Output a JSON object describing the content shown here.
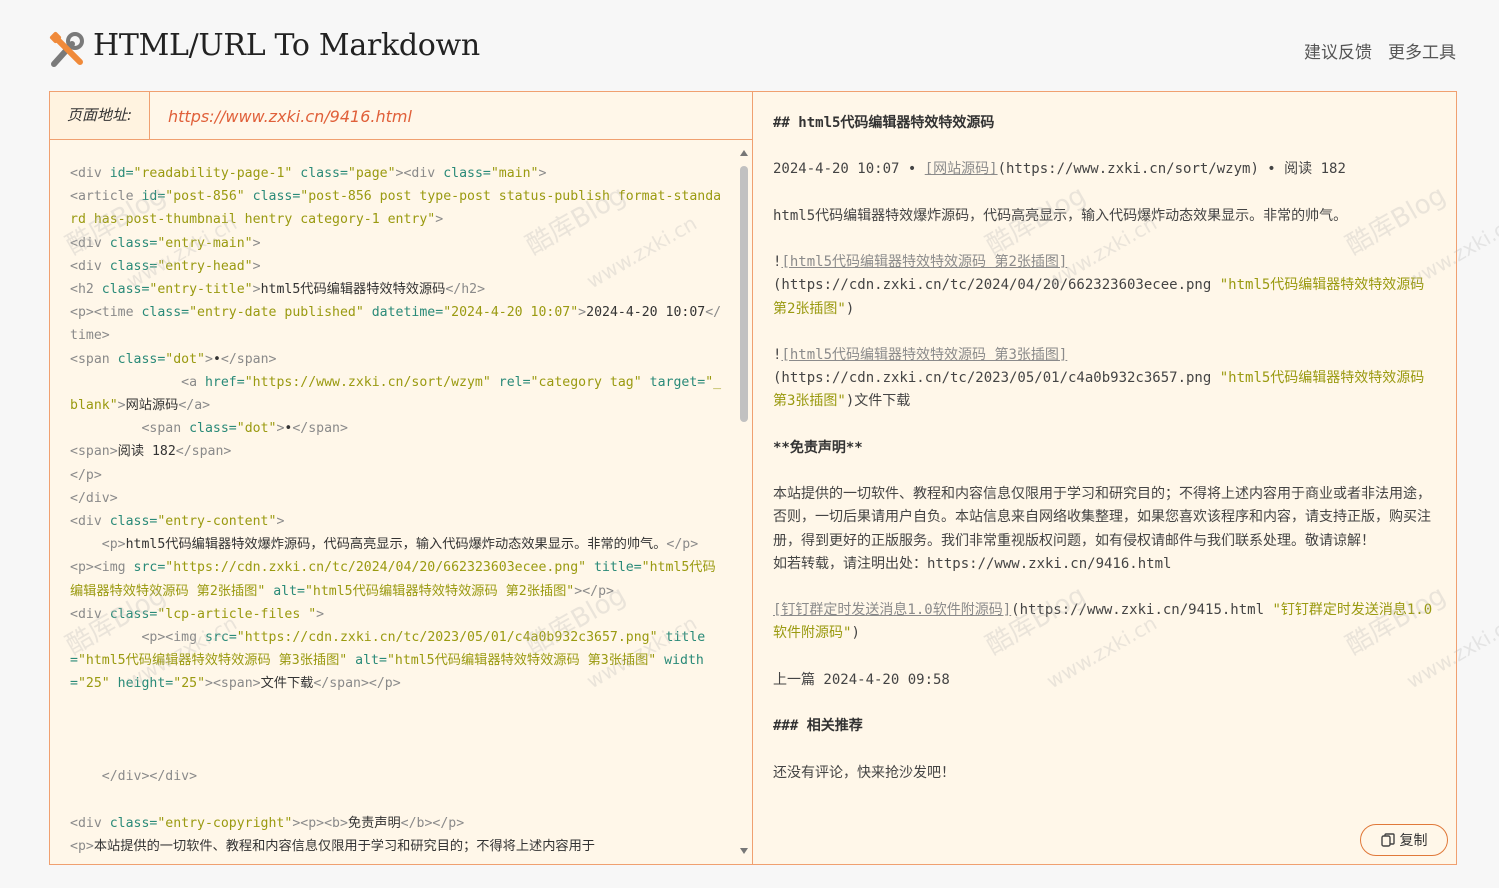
{
  "header": {
    "title": "HTML/URL To Markdown",
    "nav": [
      "建议反馈",
      "更多工具"
    ]
  },
  "url_bar": {
    "label": "页面地址:",
    "value": "https://www.zxki.cn/9416.html"
  },
  "code_lines": [
    [
      [
        "t",
        "<div "
      ],
      [
        "a",
        "id="
      ],
      [
        "v",
        "\"readability-page-1\""
      ],
      [
        "a",
        " class="
      ],
      [
        "v",
        "\"page\""
      ],
      [
        "t",
        "><div "
      ],
      [
        "a",
        "class="
      ],
      [
        "v",
        "\"main\""
      ],
      [
        "t",
        ">"
      ]
    ],
    [
      [
        "t",
        "<article "
      ],
      [
        "a",
        "id="
      ],
      [
        "v",
        "\"post-856\""
      ],
      [
        "a",
        " class="
      ],
      [
        "v",
        "\"post-856 post type-post status-publish format-standard has-post-thumbnail hentry category-1 entry\""
      ],
      [
        "t",
        ">"
      ]
    ],
    [
      [
        "t",
        "<div "
      ],
      [
        "a",
        "class="
      ],
      [
        "v",
        "\"entry-main\""
      ],
      [
        "t",
        ">"
      ]
    ],
    [
      [
        "t",
        "<div "
      ],
      [
        "a",
        "class="
      ],
      [
        "v",
        "\"entry-head\""
      ],
      [
        "t",
        ">"
      ]
    ],
    [
      [
        "t",
        "<h2 "
      ],
      [
        "a",
        "class="
      ],
      [
        "v",
        "\"entry-title\""
      ],
      [
        "t",
        ">"
      ],
      [
        "x",
        "html5代码编辑器特效特效源码"
      ],
      [
        "t",
        "</h2>"
      ]
    ],
    [
      [
        "t",
        "<p><time "
      ],
      [
        "a",
        "class="
      ],
      [
        "v",
        "\"entry-date published\""
      ],
      [
        "a",
        " datetime="
      ],
      [
        "v",
        "\"2024-4-20 10:07\""
      ],
      [
        "t",
        ">"
      ],
      [
        "x",
        "2024-4-20 10:07"
      ],
      [
        "t",
        "</time>"
      ]
    ],
    [
      [
        "t",
        "<span "
      ],
      [
        "a",
        "class="
      ],
      [
        "v",
        "\"dot\""
      ],
      [
        "t",
        ">"
      ],
      [
        "x",
        "•"
      ],
      [
        "t",
        "</span>"
      ]
    ],
    [
      [
        "x",
        "              "
      ],
      [
        "t",
        "<a "
      ],
      [
        "a",
        "href="
      ],
      [
        "v",
        "\"https://www.zxki.cn/sort/wzym\""
      ],
      [
        "a",
        " rel="
      ],
      [
        "v",
        "\"category tag\""
      ],
      [
        "a",
        " target="
      ],
      [
        "v",
        "\"_blank\""
      ],
      [
        "t",
        ">"
      ],
      [
        "x",
        "网站源码"
      ],
      [
        "t",
        "</a>"
      ]
    ],
    [
      [
        "x",
        "         "
      ],
      [
        "t",
        "<span "
      ],
      [
        "a",
        "class="
      ],
      [
        "v",
        "\"dot\""
      ],
      [
        "t",
        ">"
      ],
      [
        "x",
        "•"
      ],
      [
        "t",
        "</span>"
      ]
    ],
    [
      [
        "t",
        "<span>"
      ],
      [
        "x",
        "阅读 182"
      ],
      [
        "t",
        "</span>"
      ]
    ],
    [
      [
        "t",
        "</p>"
      ]
    ],
    [
      [
        "t",
        "</div>"
      ]
    ],
    [
      [
        "t",
        "<div "
      ],
      [
        "a",
        "class="
      ],
      [
        "v",
        "\"entry-content\""
      ],
      [
        "t",
        ">"
      ]
    ],
    [
      [
        "x",
        "    "
      ],
      [
        "t",
        "<p>"
      ],
      [
        "x",
        "html5代码编辑器特效爆炸源码，代码高亮显示，输入代码爆炸动态效果显示。非常的帅气。"
      ],
      [
        "t",
        "</p>"
      ]
    ],
    [
      [
        "t",
        "<p><img "
      ],
      [
        "a",
        "src="
      ],
      [
        "v",
        "\"https://cdn.zxki.cn/tc/2024/04/20/662323603ecee.png\""
      ],
      [
        "a",
        " title="
      ],
      [
        "v",
        "\"html5代码编辑器特效特效源码 第2张插图\""
      ],
      [
        "a",
        " alt="
      ],
      [
        "v",
        "\"html5代码编辑器特效特效源码 第2张插图\""
      ],
      [
        "t",
        "></p>"
      ]
    ],
    [
      [
        "t",
        "<div "
      ],
      [
        "a",
        "class="
      ],
      [
        "v",
        "\"lcp-article-files \""
      ],
      [
        "t",
        ">"
      ]
    ],
    [
      [
        "x",
        "         "
      ],
      [
        "t",
        "<p><img "
      ],
      [
        "a",
        "src="
      ],
      [
        "v",
        "\"https://cdn.zxki.cn/tc/2023/05/01/c4a0b932c3657.png\""
      ],
      [
        "a",
        " title="
      ],
      [
        "v",
        "\"html5代码编辑器特效特效源码 第3张插图\""
      ],
      [
        "a",
        " alt="
      ],
      [
        "v",
        "\"html5代码编辑器特效特效源码 第3张插图\""
      ],
      [
        "a",
        " width="
      ],
      [
        "v",
        "\"25\""
      ],
      [
        "a",
        " height="
      ],
      [
        "v",
        "\"25\""
      ],
      [
        "t",
        "><span>"
      ],
      [
        "x",
        "文件下载"
      ],
      [
        "t",
        "</span></p>"
      ]
    ],
    [
      [
        "x",
        ""
      ]
    ],
    [
      [
        "x",
        ""
      ]
    ],
    [
      [
        "x",
        ""
      ]
    ],
    [
      [
        "x",
        "    "
      ],
      [
        "t",
        "</div></div>"
      ]
    ],
    [
      [
        "x",
        ""
      ]
    ],
    [
      [
        "t",
        "<div "
      ],
      [
        "a",
        "class="
      ],
      [
        "v",
        "\"entry-copyright\""
      ],
      [
        "t",
        "><p><b>"
      ],
      [
        "x",
        "免责声明"
      ],
      [
        "t",
        "</b></p>"
      ]
    ],
    [
      [
        "t",
        "<p>"
      ],
      [
        "x",
        "本站提供的一切软件、教程和内容信息仅限用于学习和研究目的；不得将上述内容用于"
      ]
    ]
  ],
  "markdown": {
    "h2": "## html5代码编辑器特效特效源码",
    "meta_prefix": "2024-4-20 10:07 • ",
    "meta_link": "[网站源码]",
    "meta_suffix": "(https://www.zxki.cn/sort/wzym) • 阅读 182",
    "desc": "html5代码编辑器特效爆炸源码，代码高亮显示，输入代码爆炸动态效果显示。非常的帅气。",
    "img1_bang": "!",
    "img1_alt": "[html5代码编辑器特效特效源码 第2张插图]",
    "img1_url": "(https://cdn.zxki.cn/tc/2024/04/20/662323603ecee.png ",
    "img1_title": "\"html5代码编辑器特效特效源码 第2张插图\"",
    "img1_close": ")",
    "img2_bang": "!",
    "img2_alt": "[html5代码编辑器特效特效源码 第3张插图]",
    "img2_url": "(https://cdn.zxki.cn/tc/2023/05/01/c4a0b932c3657.png ",
    "img2_title": "\"html5代码编辑器特效特效源码 第3张插图\"",
    "img2_close": ")文件下载",
    "disclaimer_title": "**免责声明**",
    "disclaimer_body": "本站提供的一切软件、教程和内容信息仅限用于学习和研究目的；不得将上述内容用于商业或者非法用途，否则，一切后果请用户自负。本站信息来自网络收集整理，如果您喜欢该程序和内容，请支持正版，购买注册，得到更好的正版服务。我们非常重视版权问题，如有侵权请邮件与我们联系处理。敬请谅解！",
    "repost": "如若转载，请注明出处：https://www.zxki.cn/9416.html",
    "related_link": "[钉钉群定时发送消息1.0软件附源码]",
    "related_url": "(https://www.zxki.cn/9415.html ",
    "related_title": "\"钉钉群定时发送消息1.0软件附源码\"",
    "related_close": ")",
    "prev": "上一篇 2024-4-20 09:58",
    "h3": "### 相关推荐",
    "no_comment": "还没有评论，快来抢沙发吧！"
  },
  "copy_button": "复制",
  "watermark": [
    "酷库Blog",
    "www.zxki.cn"
  ],
  "colors": {
    "accent": "#e0793a",
    "panel_bg": "#fff7e9",
    "url_text": "#e0603a",
    "attr": "#2a8a78",
    "value": "#9a9a10"
  }
}
